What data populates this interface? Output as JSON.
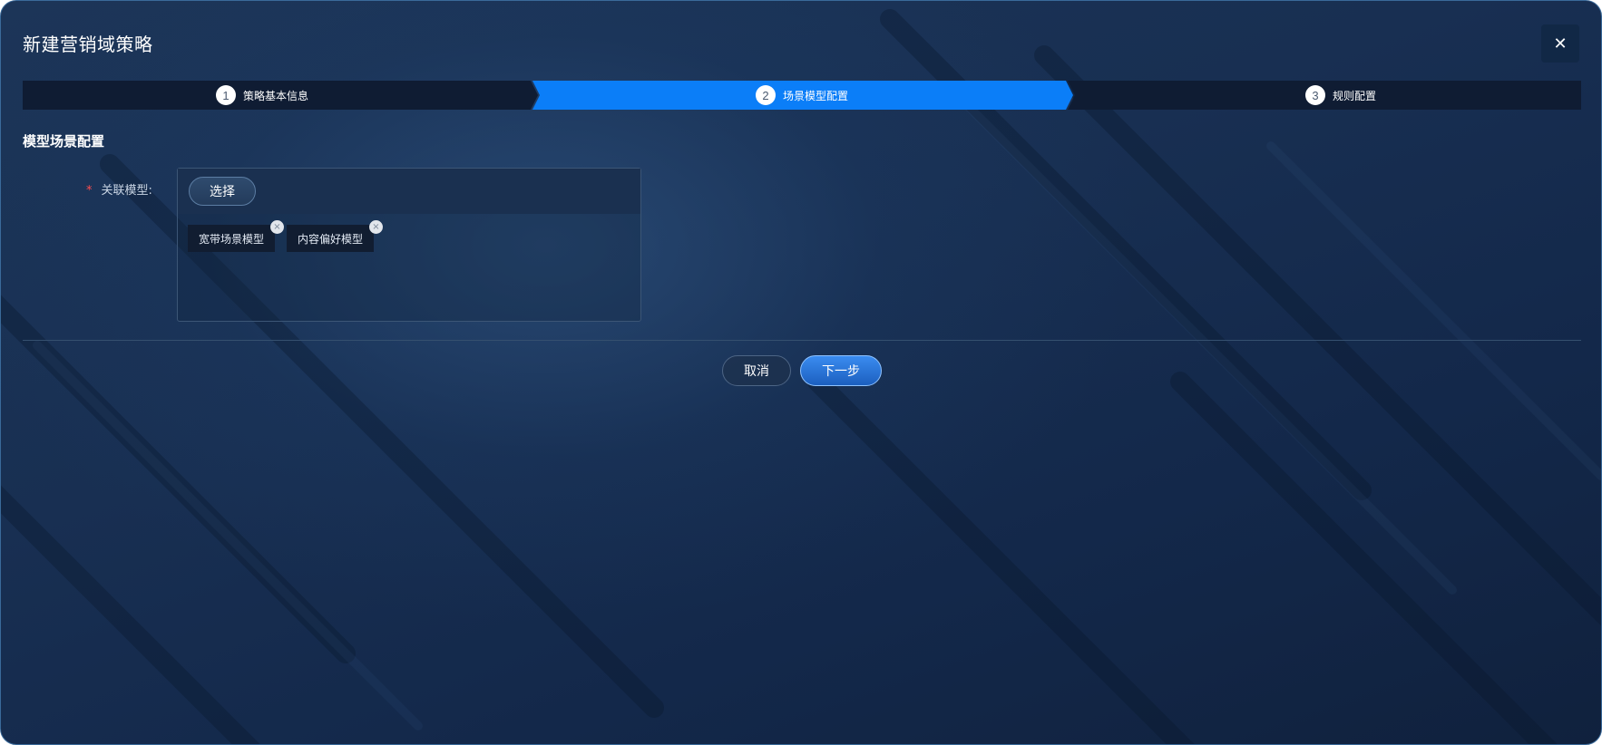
{
  "dialog": {
    "title": "新建营销域策略",
    "close_glyph": "✕"
  },
  "steps": [
    {
      "number": "1",
      "label": "策略基本信息",
      "state": "inactive"
    },
    {
      "number": "2",
      "label": "场景模型配置",
      "state": "active"
    },
    {
      "number": "3",
      "label": "规则配置",
      "state": "inactive"
    }
  ],
  "section": {
    "title": "模型场景配置"
  },
  "field": {
    "required_mark": "*",
    "label": "关联模型:",
    "select_button": "选择",
    "tags": [
      {
        "label": "宽带场景模型",
        "remove_glyph": "×"
      },
      {
        "label": "内容偏好模型",
        "remove_glyph": "×"
      }
    ]
  },
  "footer": {
    "cancel_label": "取消",
    "next_label": "下一步"
  },
  "colors": {
    "step_active": "#0b7ef8",
    "step_inactive": "#0f1c33",
    "accent": "#2f82ea",
    "required": "#ff4d4f"
  }
}
